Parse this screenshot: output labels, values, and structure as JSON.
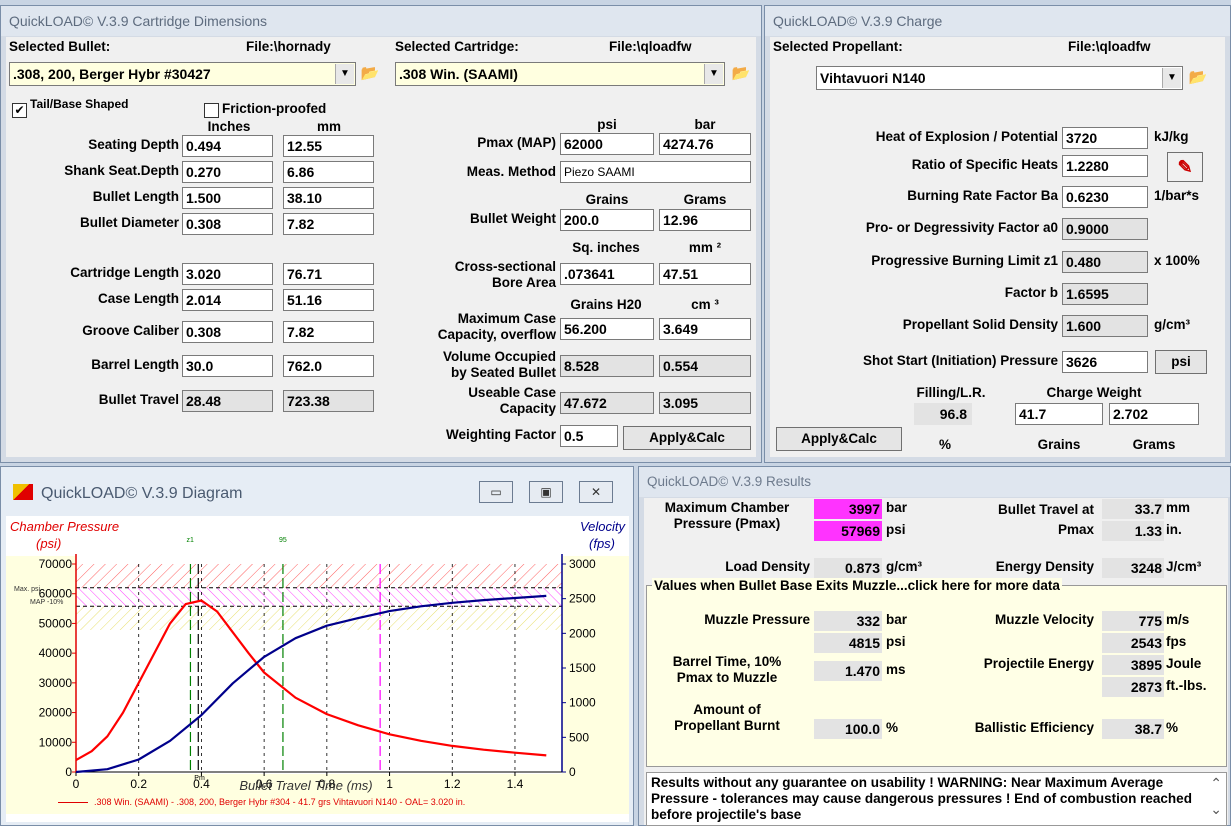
{
  "dimensions": {
    "title": "QuickLOAD© V.3.9 Cartridge Dimensions",
    "bullet_label": "Selected Bullet:",
    "bullet_file": "File:\\hornady",
    "bullet_value": ".308, 200, Berger Hybr #30427",
    "cartridge_label": "Selected Cartridge:",
    "cartridge_file": "File:\\qloadfw",
    "cartridge_value": ".308 Win. (SAAMI)",
    "tail_label": "Tail/Base Shaped",
    "tail_check": "✔",
    "friction_label": "Friction-proofed",
    "col_inches": "Inches",
    "col_mm": "mm",
    "rows": [
      {
        "label": "Seating Depth",
        "inches": "0.494",
        "mm": "12.55"
      },
      {
        "label": "Shank Seat.Depth",
        "inches": "0.270",
        "mm": "6.86"
      },
      {
        "label": "Bullet Length",
        "inches": "1.500",
        "mm": "38.10"
      },
      {
        "label": "Bullet Diameter",
        "inches": "0.308",
        "mm": "7.82"
      },
      {
        "label": "Cartridge Length",
        "inches": "3.020",
        "mm": "76.71"
      },
      {
        "label": "Case Length",
        "inches": "2.014",
        "mm": "51.16"
      },
      {
        "label": "Groove Caliber",
        "inches": "0.308",
        "mm": "7.82"
      },
      {
        "label": "Barrel Length",
        "inches": "30.0",
        "mm": "762.0"
      },
      {
        "label": "Bullet Travel",
        "inches": "28.48",
        "mm": "723.38"
      }
    ],
    "psi_head": "psi",
    "bar_head": "bar",
    "pmax_label": "Pmax (MAP)",
    "pmax_psi": "62000",
    "pmax_bar": "4274.76",
    "meas_label": "Meas. Method",
    "meas_value": "Piezo SAAMI",
    "grains_head": "Grains",
    "grams_head": "Grams",
    "weight_label": "Bullet Weight",
    "weight_grains": "200.0",
    "weight_grams": "12.96",
    "sqin_head": "Sq. inches",
    "mm2_head": "mm ²",
    "bore_label1": "Cross-sectional",
    "bore_label2": "Bore Area",
    "bore_sqin": ".073641",
    "bore_mm2": "47.51",
    "grainsh2o_head": "Grains H20",
    "cm3_head": "cm ³",
    "cap_label1": "Maximum Case",
    "cap_label2": "Capacity, overflow",
    "cap_grains": "56.200",
    "cap_cm3": "3.649",
    "vol_label1": "Volume Occupied",
    "vol_label2": "by Seated Bullet",
    "vol_grains": "8.528",
    "vol_cm3": "0.554",
    "use_label1": "Useable Case",
    "use_label2": "Capacity",
    "use_grains": "47.672",
    "use_cm3": "3.095",
    "wf_label": "Weighting Factor",
    "wf_value": "0.5",
    "apply_label": "Apply&Calc"
  },
  "charge": {
    "title": "QuickLOAD© V.3.9 Charge",
    "prop_label": "Selected Propellant:",
    "prop_file": "File:\\qloadfw",
    "prop_value": "Vihtavuori N140",
    "rows": [
      {
        "label": "Heat of Explosion / Potential",
        "value": "3720",
        "unit": "kJ/kg"
      },
      {
        "label": "Ratio of Specific Heats",
        "value": "1.2280",
        "unit": ""
      },
      {
        "label": "Burning Rate Factor  Ba",
        "value": "0.6230",
        "unit": "1/bar*s"
      },
      {
        "label": "Pro- or Degressivity Factor  a0",
        "value": "0.9000",
        "unit": ""
      },
      {
        "label": "Progressive Burning Limit z1",
        "value": "0.480",
        "unit": "x 100%"
      },
      {
        "label": "Factor  b",
        "value": "1.6595",
        "unit": ""
      },
      {
        "label": "Propellant Solid Density",
        "value": "1.600",
        "unit": "g/cm³"
      }
    ],
    "shot_label": "Shot Start (Initiation) Pressure",
    "shot_value": "3626",
    "shot_unit": "psi",
    "fill_head": "Filling/L.R.",
    "fill_value": "96.8",
    "fill_unit": "%",
    "cw_head": "Charge Weight",
    "cw_grains": "41.7",
    "cw_grams": "2.702",
    "grains_unit": "Grains",
    "grams_unit": "Grams",
    "apply_label": "Apply&Calc"
  },
  "diagram": {
    "title": "QuickLOAD© V.3.9 Diagram",
    "btn_min": "▭",
    "btn_max": "▣",
    "btn_close": "✕",
    "left_label1": "Chamber Pressure",
    "left_label2": "(psi)",
    "right_label1": "Velocity",
    "right_label2": "(fps)",
    "xlabel": "Bullet Travel Time (ms)",
    "legend": ".308 Win. (SAAMI) - .308, 200, Berger Hybr #304 - 41.7 grs Vihtavuori N140 - OAL= 3.020 in.",
    "mark_z1": "z1",
    "mark_95": "95",
    "mark_pm": "Pm",
    "mark_tiny1": "Max. psi",
    "mark_tiny2": "MAP -10%"
  },
  "chart_data": {
    "type": "line",
    "title": "",
    "xlabel": "Bullet Travel Time (ms)",
    "ylabel": "Chamber Pressure (psi)",
    "y2label": "Velocity (fps)",
    "xlim": [
      0,
      1.55
    ],
    "ylim": [
      0,
      70000
    ],
    "y2lim": [
      0,
      3000
    ],
    "x_ticks": [
      0,
      0.2,
      0.4,
      0.6,
      0.8,
      1.0,
      1.2,
      1.4
    ],
    "y_ticks": [
      0,
      10000,
      20000,
      30000,
      40000,
      50000,
      60000,
      70000
    ],
    "y2_ticks": [
      0,
      500,
      1000,
      1500,
      2000,
      2500,
      3000
    ],
    "series": [
      {
        "name": "Chamber Pressure",
        "axis": "left",
        "color": "#ff0000",
        "x": [
          0,
          0.05,
          0.1,
          0.15,
          0.2,
          0.25,
          0.3,
          0.35,
          0.4,
          0.45,
          0.5,
          0.55,
          0.6,
          0.7,
          0.8,
          0.9,
          1.0,
          1.1,
          1.2,
          1.3,
          1.4,
          1.5
        ],
        "y": [
          4000,
          7000,
          12000,
          20000,
          30000,
          40000,
          50000,
          56500,
          57700,
          54000,
          47000,
          40000,
          33500,
          25000,
          19500,
          15700,
          12700,
          10500,
          8800,
          7500,
          6500,
          5600
        ]
      },
      {
        "name": "Velocity",
        "axis": "right",
        "color": "#00008b",
        "x": [
          0,
          0.1,
          0.2,
          0.3,
          0.4,
          0.5,
          0.6,
          0.7,
          0.8,
          0.9,
          1.0,
          1.1,
          1.2,
          1.3,
          1.4,
          1.5
        ],
        "y": [
          0,
          40,
          180,
          450,
          820,
          1280,
          1660,
          1930,
          2110,
          2220,
          2320,
          2390,
          2440,
          2480,
          2510,
          2540
        ]
      }
    ],
    "max_map_psi": 62000,
    "map_minus10_psi": 55800,
    "markers_x": [
      0.365,
      0.39,
      0.66,
      0.97
    ]
  },
  "results": {
    "title": "QuickLOAD© V.3.9 Results",
    "maxp_label1": "Maximum Chamber",
    "maxp_label2": "Pressure (Pmax)",
    "maxp_bar": "3997",
    "maxp_psi": "57969",
    "unit_bar": "bar",
    "unit_psi": "psi",
    "bt_label1": "Bullet Travel at",
    "bt_label2": "Pmax",
    "bt_mm": "33.7",
    "bt_in": "1.33",
    "unit_mm": "mm",
    "unit_in": "in.",
    "ld_label": "Load Density",
    "ld_value": "0.873",
    "ld_unit": "g/cm³",
    "ed_label": "Energy Density",
    "ed_value": "3248",
    "ed_unit": "J/cm³",
    "section_title": "Values when Bullet Base Exits Muzzle...click here for more data",
    "mp_label": "Muzzle Pressure",
    "mp_bar": "332",
    "mp_psi": "4815",
    "mv_label": "Muzzle Velocity",
    "mv_ms": "775",
    "mv_fps": "2543",
    "unit_ms": "m/s",
    "unit_fps": "fps",
    "btime_label1": "Barrel Time, 10%",
    "btime_label2": "Pmax to Muzzle",
    "btime_value": "1.470",
    "btime_unit": "ms",
    "pe_label": "Projectile Energy",
    "pe_joule": "3895",
    "pe_ftlbs": "2873",
    "unit_joule": "Joule",
    "unit_ftlbs": "ft.-lbs.",
    "burnt_label1": "Amount of",
    "burnt_label2": "Propellant Burnt",
    "burnt_value": "100.0",
    "burnt_unit": "%",
    "be_label": "Ballistic Efficiency",
    "be_value": "38.7",
    "be_unit": "%",
    "warning": "Results without any guarantee on usability !  WARNING: Near Maximum Average Pressure - tolerances may cause dangerous pressures !  End of combustion reached before projectile's base",
    "scroll_up": "⌃",
    "scroll_down": "⌄"
  }
}
